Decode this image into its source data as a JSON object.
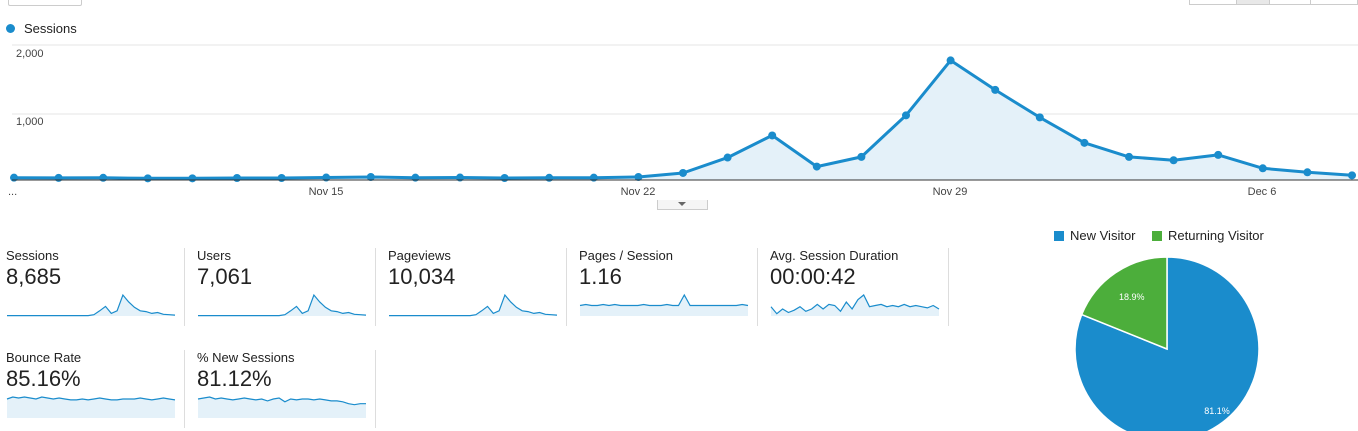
{
  "colors": {
    "series": "#1a8ccc",
    "returning": "#4cae3b",
    "grid": "#e5e5e5",
    "fill": "#e4f1f9"
  },
  "chart_data": [
    {
      "type": "line",
      "legend": [
        "Sessions"
      ],
      "series": [
        {
          "name": "Sessions",
          "values": [
            20,
            17,
            18,
            10,
            10,
            15,
            15,
            22,
            30,
            20,
            22,
            15,
            18,
            20,
            30,
            90,
            320,
            650,
            185,
            330,
            950,
            1770,
            1330,
            920,
            540,
            330,
            280,
            360,
            160,
            100,
            55
          ]
        }
      ],
      "x_tick_labels": [
        "...",
        "Nov 15",
        "Nov 22",
        "Nov 29",
        "Dec 6"
      ],
      "y_tick_labels": [
        "2,000",
        "1,000"
      ],
      "ylim": [
        0,
        2000
      ]
    },
    {
      "type": "pie",
      "legend": [
        "New Visitor",
        "Returning Visitor"
      ],
      "slices": [
        {
          "label": "New Visitor",
          "value": 81.1,
          "text": "81.1%"
        },
        {
          "label": "Returning Visitor",
          "value": 18.9,
          "text": "18.9%"
        }
      ]
    }
  ],
  "metrics": [
    {
      "label": "Sessions",
      "value": "8,685"
    },
    {
      "label": "Users",
      "value": "7,061"
    },
    {
      "label": "Pageviews",
      "value": "10,034"
    },
    {
      "label": "Pages / Session",
      "value": "1.16"
    },
    {
      "label": "Avg. Session Duration",
      "value": "00:00:42"
    },
    {
      "label": "Bounce Rate",
      "value": "85.16%"
    },
    {
      "label": "% New Sessions",
      "value": "81.12%"
    }
  ],
  "sparklines": [
    [
      1,
      1,
      1,
      1,
      1,
      1,
      1,
      1,
      1,
      1,
      1,
      1,
      1,
      1,
      1,
      3,
      12,
      22,
      6,
      12,
      48,
      32,
      20,
      12,
      10,
      6,
      8,
      4,
      3,
      2
    ],
    [
      1,
      1,
      1,
      1,
      1,
      1,
      1,
      1,
      1,
      1,
      1,
      1,
      1,
      1,
      1,
      3,
      12,
      22,
      6,
      12,
      48,
      32,
      20,
      12,
      10,
      6,
      8,
      4,
      3,
      2
    ],
    [
      1,
      1,
      1,
      1,
      1,
      1,
      1,
      1,
      1,
      1,
      1,
      1,
      1,
      1,
      1,
      3,
      12,
      22,
      6,
      12,
      48,
      32,
      20,
      12,
      10,
      6,
      8,
      4,
      3,
      2
    ],
    [
      10,
      11,
      10,
      10,
      11,
      10,
      11,
      10,
      10,
      10,
      10,
      11,
      10,
      10,
      10,
      11,
      10,
      10,
      20,
      10,
      10,
      10,
      10,
      10,
      10,
      10,
      10,
      10,
      11,
      10
    ],
    [
      8,
      2,
      6,
      3,
      5,
      8,
      4,
      6,
      10,
      6,
      10,
      9,
      4,
      12,
      6,
      14,
      18,
      8,
      9,
      10,
      8,
      9,
      8,
      10,
      8,
      9,
      8,
      7,
      9,
      6
    ],
    [
      20,
      22,
      21,
      22,
      21,
      20,
      22,
      21,
      20,
      21,
      20,
      19,
      19,
      20,
      19,
      20,
      21,
      20,
      19,
      19,
      20,
      20,
      20,
      21,
      20,
      19,
      20,
      21,
      20,
      19
    ],
    [
      20,
      21,
      22,
      20,
      21,
      20,
      19,
      20,
      21,
      20,
      19,
      20,
      18,
      20,
      21,
      17,
      20,
      19,
      20,
      20,
      19,
      20,
      19,
      18,
      18,
      17,
      15,
      14,
      15,
      15
    ]
  ]
}
